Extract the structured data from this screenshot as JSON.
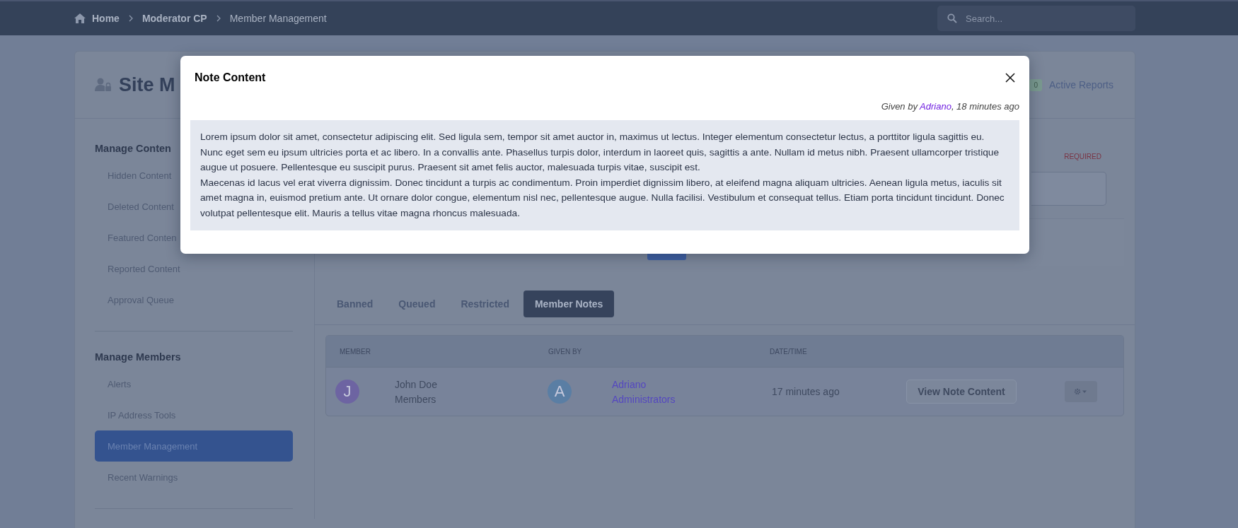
{
  "header": {
    "breadcrumbs": [
      "Home",
      "Moderator CP",
      "Member Management"
    ],
    "search": {
      "placeholder": "Search..."
    }
  },
  "page": {
    "title": "Site M",
    "active_reports": {
      "count": "0",
      "label": "Active Reports"
    }
  },
  "sidebar": {
    "sections": [
      {
        "title": "Manage Conten",
        "items": [
          {
            "label": "Hidden Content",
            "selected": false
          },
          {
            "label": "Deleted Content",
            "selected": false
          },
          {
            "label": "Featured Conten",
            "selected": false
          },
          {
            "label": "Reported Content",
            "selected": false
          },
          {
            "label": "Approval Queue",
            "selected": false
          }
        ]
      },
      {
        "title": "Manage Members",
        "items": [
          {
            "label": "Alerts",
            "selected": false
          },
          {
            "label": "IP Address Tools",
            "selected": false
          },
          {
            "label": "Member Management",
            "selected": true
          },
          {
            "label": "Recent Warnings",
            "selected": false
          }
        ]
      }
    ]
  },
  "form": {
    "required_label": "REQUIRED"
  },
  "tabs": [
    {
      "label": "Banned",
      "selected": false
    },
    {
      "label": "Queued",
      "selected": false
    },
    {
      "label": "Restricted",
      "selected": false
    },
    {
      "label": "Member Notes",
      "selected": true
    }
  ],
  "table": {
    "columns": [
      "MEMBER",
      "GIVEN BY",
      "DATE/TIME"
    ],
    "rows": [
      {
        "member_initial": "J",
        "member_name": "John Doe",
        "member_group": "Members",
        "giver_initial": "A",
        "giver_name": "Adriano",
        "giver_group": "Administrators",
        "time": "17 minutes ago",
        "action": "View Note Content"
      }
    ]
  },
  "modal": {
    "title": "Note Content",
    "given_prefix": "Given by ",
    "given_link": "Adriano",
    "given_suffix": ", 18 minutes ago",
    "paragraphs": [
      "Lorem ipsum dolor sit amet, consectetur adipiscing elit. Sed ligula sem, tempor sit amet auctor in, maximus ut lectus. Integer elementum consectetur lectus, a porttitor ligula sagittis eu. Nunc eget sem eu ipsum ultricies porta et ac libero. In a convallis ante. Phasellus turpis dolor, interdum in laoreet quis, sagittis a ante. Nullam id metus nibh. Praesent ullamcorper tristique augue ut posuere. Pellentesque eu suscipit purus. Praesent sit amet felis auctor, malesuada turpis vitae, suscipit est.",
      "Maecenas id lacus vel erat viverra dignissim. Donec tincidunt a turpis ac condimentum. Proin imperdiet dignissim libero, at eleifend magna aliquam ultricies. Aenean ligula metus, iaculis sit amet magna in, euismod pretium ante. Ut ornare dolor congue, elementum nisl nec, pellentesque augue. Nulla facilisi. Vestibulum et consequat tellus. Etiam porta tincidunt tincidunt. Donec volutpat pellentesque elit. Mauris a tellus vitae magna rhoncus malesuada."
    ]
  }
}
